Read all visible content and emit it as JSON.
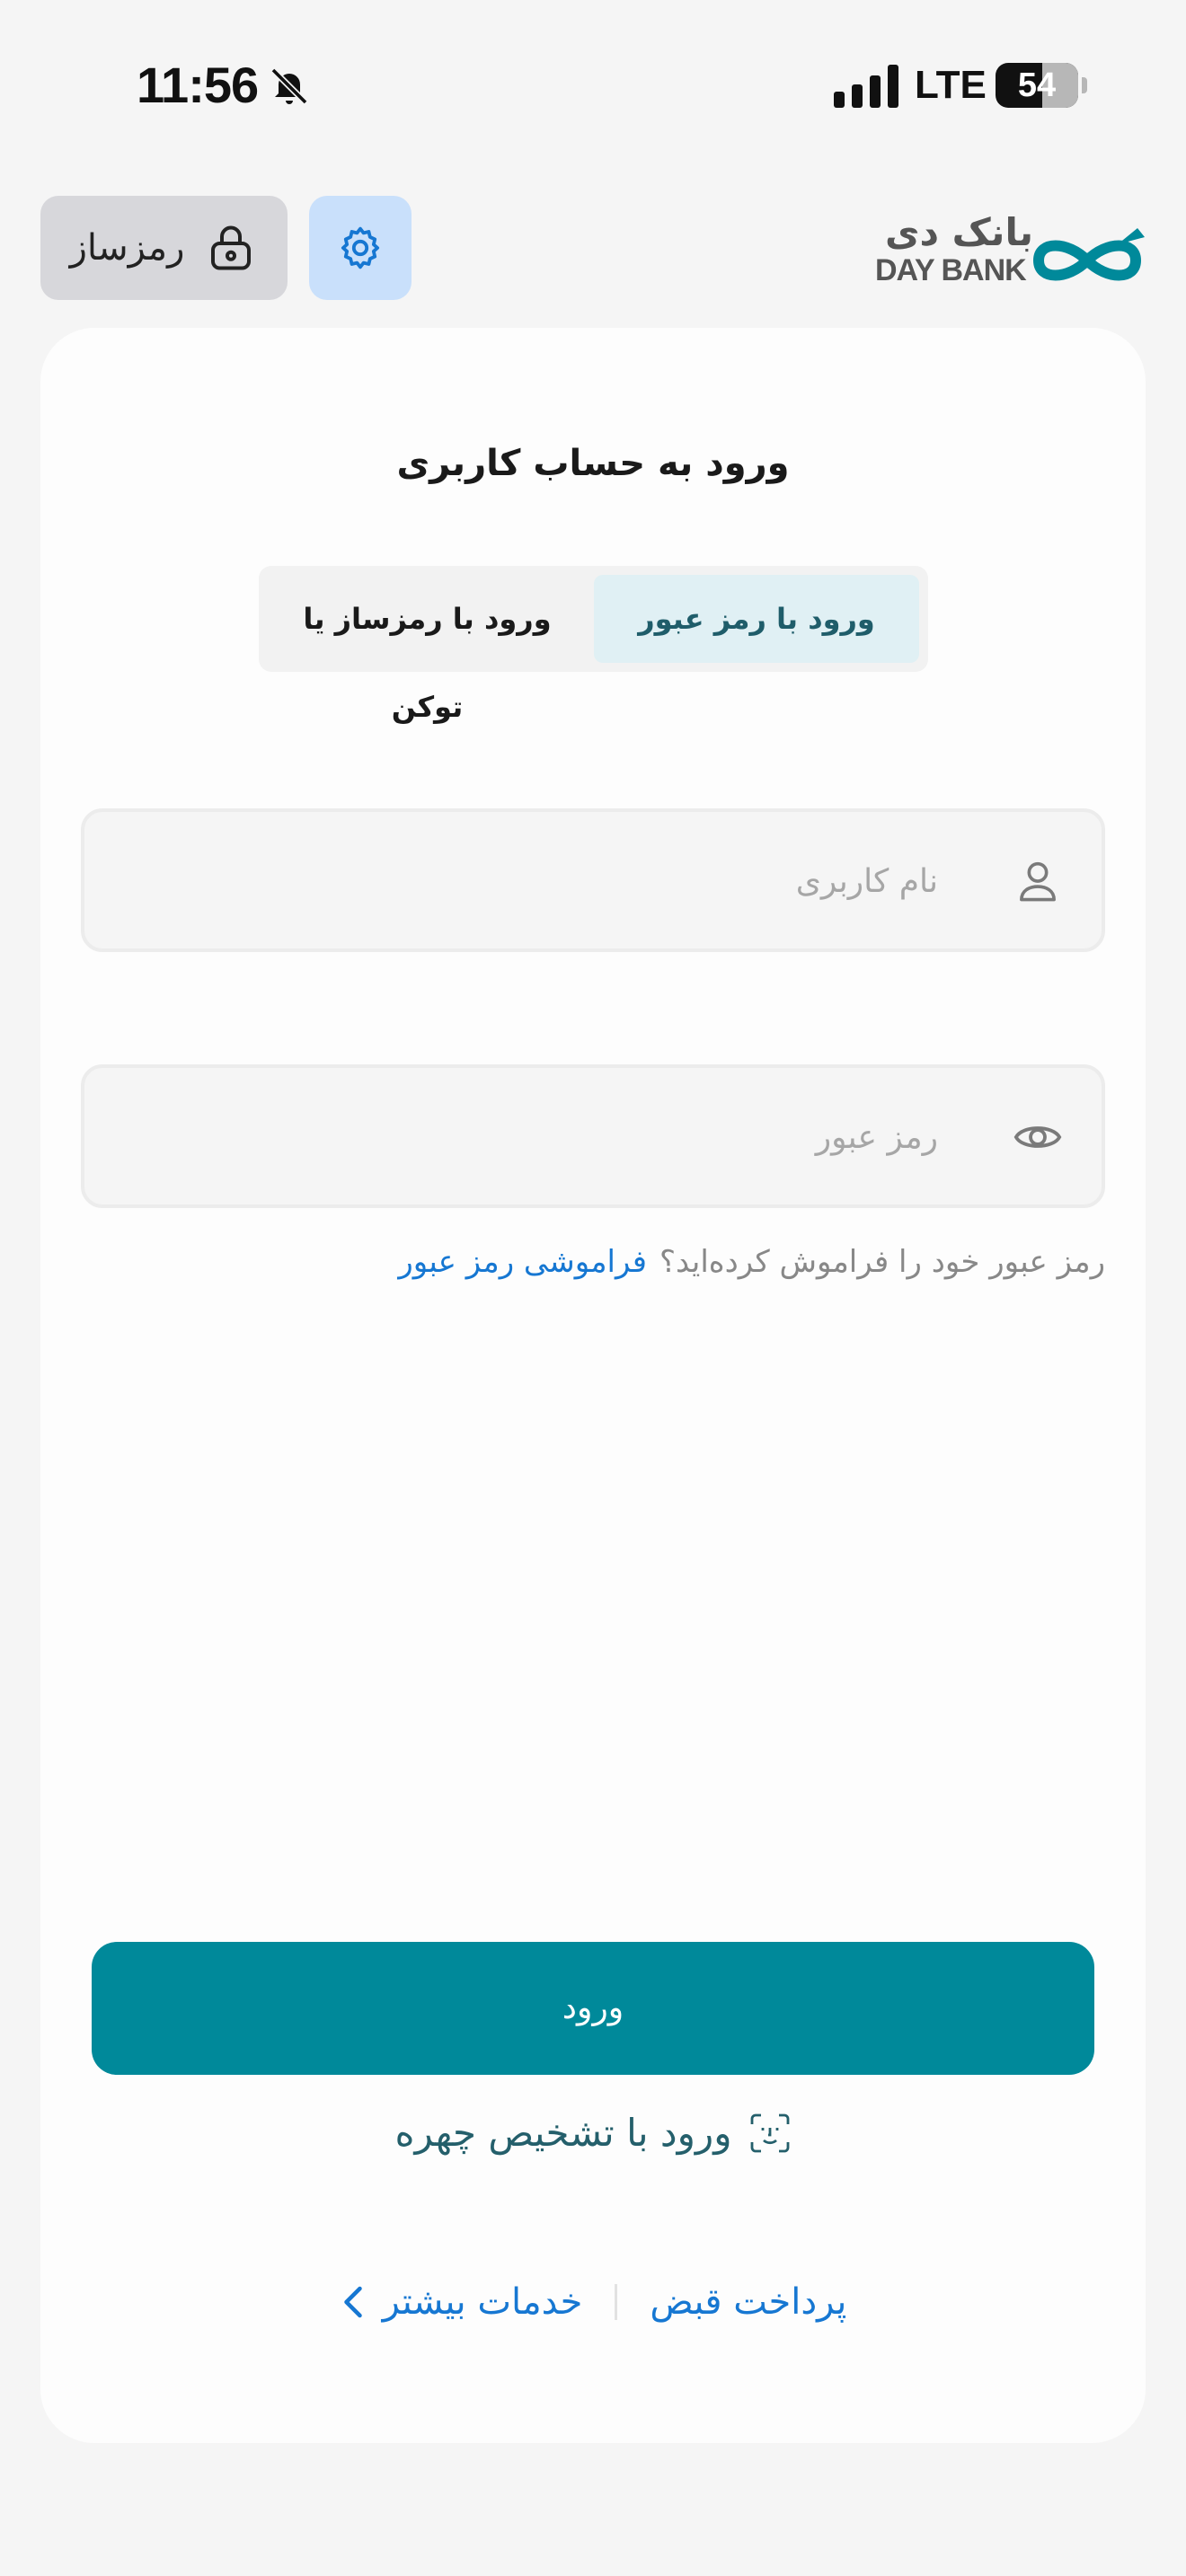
{
  "status_bar": {
    "time": "11:56",
    "network": "LTE",
    "battery": "54"
  },
  "header": {
    "ramzsaz_label": "رمزساز",
    "logo_fa": "بانک دی",
    "logo_en": "DAY BANK",
    "accent_color": "#00899a"
  },
  "card": {
    "title": "ورود به حساب کاربری",
    "tabs": [
      {
        "label": "ورود با رمز عبور",
        "active": true
      },
      {
        "label": "ورود با رمزساز یا توکن",
        "active": false
      }
    ],
    "username": {
      "placeholder": "نام کاربری",
      "value": ""
    },
    "password": {
      "placeholder": "رمز عبور",
      "value": ""
    },
    "forgot_question": "رمز عبور خود را فراموش کرده‌اید؟",
    "forgot_link": "فراموشی رمز عبور",
    "login_button": "ورود",
    "face_login": "ورود با تشخیص چهره",
    "bottom_links": {
      "bill_payment": "پرداخت قبض",
      "more_services": "خدمات بیشتر"
    }
  },
  "icons": [
    "bell-slash-icon",
    "signal-icon",
    "battery-icon",
    "lock-icon",
    "gear-icon",
    "user-icon",
    "eye-icon",
    "face-id-icon",
    "chevron-left-icon"
  ]
}
